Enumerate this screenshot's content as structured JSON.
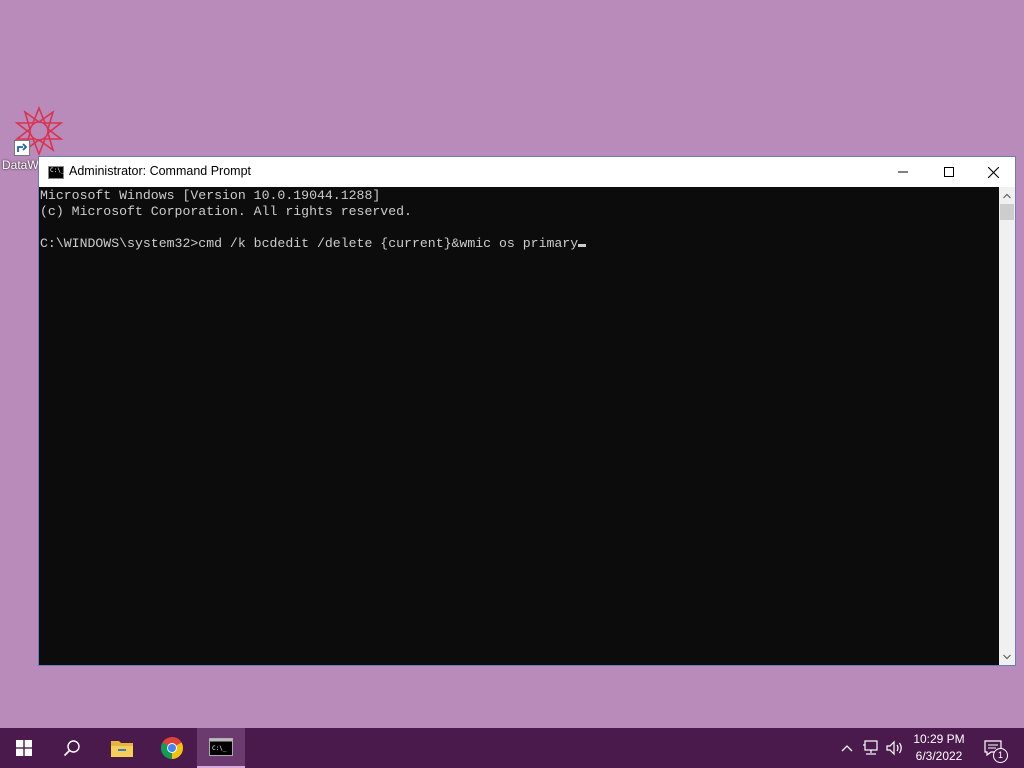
{
  "desktop": {
    "icons": [
      {
        "label": "DataW",
        "icon": "datawarrior-icon"
      }
    ],
    "background_color": "#b98bbb"
  },
  "window": {
    "title": "Administrator: Command Prompt",
    "controls": [
      "minimize",
      "maximize",
      "close"
    ],
    "console": {
      "lines": [
        "Microsoft Windows [Version 10.0.19044.1288]",
        "(c) Microsoft Corporation. All rights reserved.",
        "",
        "C:\\WINDOWS\\system32>cmd /k bcdedit /delete {current}&wmic os primary"
      ]
    }
  },
  "taskbar": {
    "items": [
      "start-icon",
      "search-icon",
      "file-explorer-icon",
      "chrome-icon",
      "command-prompt-icon"
    ],
    "active_item": "command-prompt-icon",
    "tray": [
      "show-hidden-icons",
      "network-icon",
      "volume-icon"
    ],
    "time": "10:29 PM",
    "date": "6/3/2022",
    "notification_count": "1",
    "color": "#4b1a4d"
  }
}
